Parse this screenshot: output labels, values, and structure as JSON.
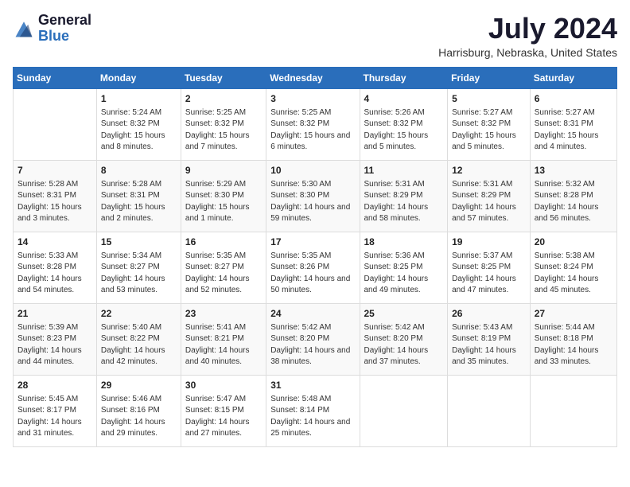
{
  "logo": {
    "general": "General",
    "blue": "Blue"
  },
  "header": {
    "month_year": "July 2024",
    "location": "Harrisburg, Nebraska, United States"
  },
  "days_of_week": [
    "Sunday",
    "Monday",
    "Tuesday",
    "Wednesday",
    "Thursday",
    "Friday",
    "Saturday"
  ],
  "weeks": [
    [
      {
        "day": "",
        "sunrise": "",
        "sunset": "",
        "daylight": ""
      },
      {
        "day": "1",
        "sunrise": "Sunrise: 5:24 AM",
        "sunset": "Sunset: 8:32 PM",
        "daylight": "Daylight: 15 hours and 8 minutes."
      },
      {
        "day": "2",
        "sunrise": "Sunrise: 5:25 AM",
        "sunset": "Sunset: 8:32 PM",
        "daylight": "Daylight: 15 hours and 7 minutes."
      },
      {
        "day": "3",
        "sunrise": "Sunrise: 5:25 AM",
        "sunset": "Sunset: 8:32 PM",
        "daylight": "Daylight: 15 hours and 6 minutes."
      },
      {
        "day": "4",
        "sunrise": "Sunrise: 5:26 AM",
        "sunset": "Sunset: 8:32 PM",
        "daylight": "Daylight: 15 hours and 5 minutes."
      },
      {
        "day": "5",
        "sunrise": "Sunrise: 5:27 AM",
        "sunset": "Sunset: 8:32 PM",
        "daylight": "Daylight: 15 hours and 5 minutes."
      },
      {
        "day": "6",
        "sunrise": "Sunrise: 5:27 AM",
        "sunset": "Sunset: 8:31 PM",
        "daylight": "Daylight: 15 hours and 4 minutes."
      }
    ],
    [
      {
        "day": "7",
        "sunrise": "Sunrise: 5:28 AM",
        "sunset": "Sunset: 8:31 PM",
        "daylight": "Daylight: 15 hours and 3 minutes."
      },
      {
        "day": "8",
        "sunrise": "Sunrise: 5:28 AM",
        "sunset": "Sunset: 8:31 PM",
        "daylight": "Daylight: 15 hours and 2 minutes."
      },
      {
        "day": "9",
        "sunrise": "Sunrise: 5:29 AM",
        "sunset": "Sunset: 8:30 PM",
        "daylight": "Daylight: 15 hours and 1 minute."
      },
      {
        "day": "10",
        "sunrise": "Sunrise: 5:30 AM",
        "sunset": "Sunset: 8:30 PM",
        "daylight": "Daylight: 14 hours and 59 minutes."
      },
      {
        "day": "11",
        "sunrise": "Sunrise: 5:31 AM",
        "sunset": "Sunset: 8:29 PM",
        "daylight": "Daylight: 14 hours and 58 minutes."
      },
      {
        "day": "12",
        "sunrise": "Sunrise: 5:31 AM",
        "sunset": "Sunset: 8:29 PM",
        "daylight": "Daylight: 14 hours and 57 minutes."
      },
      {
        "day": "13",
        "sunrise": "Sunrise: 5:32 AM",
        "sunset": "Sunset: 8:28 PM",
        "daylight": "Daylight: 14 hours and 56 minutes."
      }
    ],
    [
      {
        "day": "14",
        "sunrise": "Sunrise: 5:33 AM",
        "sunset": "Sunset: 8:28 PM",
        "daylight": "Daylight: 14 hours and 54 minutes."
      },
      {
        "day": "15",
        "sunrise": "Sunrise: 5:34 AM",
        "sunset": "Sunset: 8:27 PM",
        "daylight": "Daylight: 14 hours and 53 minutes."
      },
      {
        "day": "16",
        "sunrise": "Sunrise: 5:35 AM",
        "sunset": "Sunset: 8:27 PM",
        "daylight": "Daylight: 14 hours and 52 minutes."
      },
      {
        "day": "17",
        "sunrise": "Sunrise: 5:35 AM",
        "sunset": "Sunset: 8:26 PM",
        "daylight": "Daylight: 14 hours and 50 minutes."
      },
      {
        "day": "18",
        "sunrise": "Sunrise: 5:36 AM",
        "sunset": "Sunset: 8:25 PM",
        "daylight": "Daylight: 14 hours and 49 minutes."
      },
      {
        "day": "19",
        "sunrise": "Sunrise: 5:37 AM",
        "sunset": "Sunset: 8:25 PM",
        "daylight": "Daylight: 14 hours and 47 minutes."
      },
      {
        "day": "20",
        "sunrise": "Sunrise: 5:38 AM",
        "sunset": "Sunset: 8:24 PM",
        "daylight": "Daylight: 14 hours and 45 minutes."
      }
    ],
    [
      {
        "day": "21",
        "sunrise": "Sunrise: 5:39 AM",
        "sunset": "Sunset: 8:23 PM",
        "daylight": "Daylight: 14 hours and 44 minutes."
      },
      {
        "day": "22",
        "sunrise": "Sunrise: 5:40 AM",
        "sunset": "Sunset: 8:22 PM",
        "daylight": "Daylight: 14 hours and 42 minutes."
      },
      {
        "day": "23",
        "sunrise": "Sunrise: 5:41 AM",
        "sunset": "Sunset: 8:21 PM",
        "daylight": "Daylight: 14 hours and 40 minutes."
      },
      {
        "day": "24",
        "sunrise": "Sunrise: 5:42 AM",
        "sunset": "Sunset: 8:20 PM",
        "daylight": "Daylight: 14 hours and 38 minutes."
      },
      {
        "day": "25",
        "sunrise": "Sunrise: 5:42 AM",
        "sunset": "Sunset: 8:20 PM",
        "daylight": "Daylight: 14 hours and 37 minutes."
      },
      {
        "day": "26",
        "sunrise": "Sunrise: 5:43 AM",
        "sunset": "Sunset: 8:19 PM",
        "daylight": "Daylight: 14 hours and 35 minutes."
      },
      {
        "day": "27",
        "sunrise": "Sunrise: 5:44 AM",
        "sunset": "Sunset: 8:18 PM",
        "daylight": "Daylight: 14 hours and 33 minutes."
      }
    ],
    [
      {
        "day": "28",
        "sunrise": "Sunrise: 5:45 AM",
        "sunset": "Sunset: 8:17 PM",
        "daylight": "Daylight: 14 hours and 31 minutes."
      },
      {
        "day": "29",
        "sunrise": "Sunrise: 5:46 AM",
        "sunset": "Sunset: 8:16 PM",
        "daylight": "Daylight: 14 hours and 29 minutes."
      },
      {
        "day": "30",
        "sunrise": "Sunrise: 5:47 AM",
        "sunset": "Sunset: 8:15 PM",
        "daylight": "Daylight: 14 hours and 27 minutes."
      },
      {
        "day": "31",
        "sunrise": "Sunrise: 5:48 AM",
        "sunset": "Sunset: 8:14 PM",
        "daylight": "Daylight: 14 hours and 25 minutes."
      },
      {
        "day": "",
        "sunrise": "",
        "sunset": "",
        "daylight": ""
      },
      {
        "day": "",
        "sunrise": "",
        "sunset": "",
        "daylight": ""
      },
      {
        "day": "",
        "sunrise": "",
        "sunset": "",
        "daylight": ""
      }
    ]
  ]
}
